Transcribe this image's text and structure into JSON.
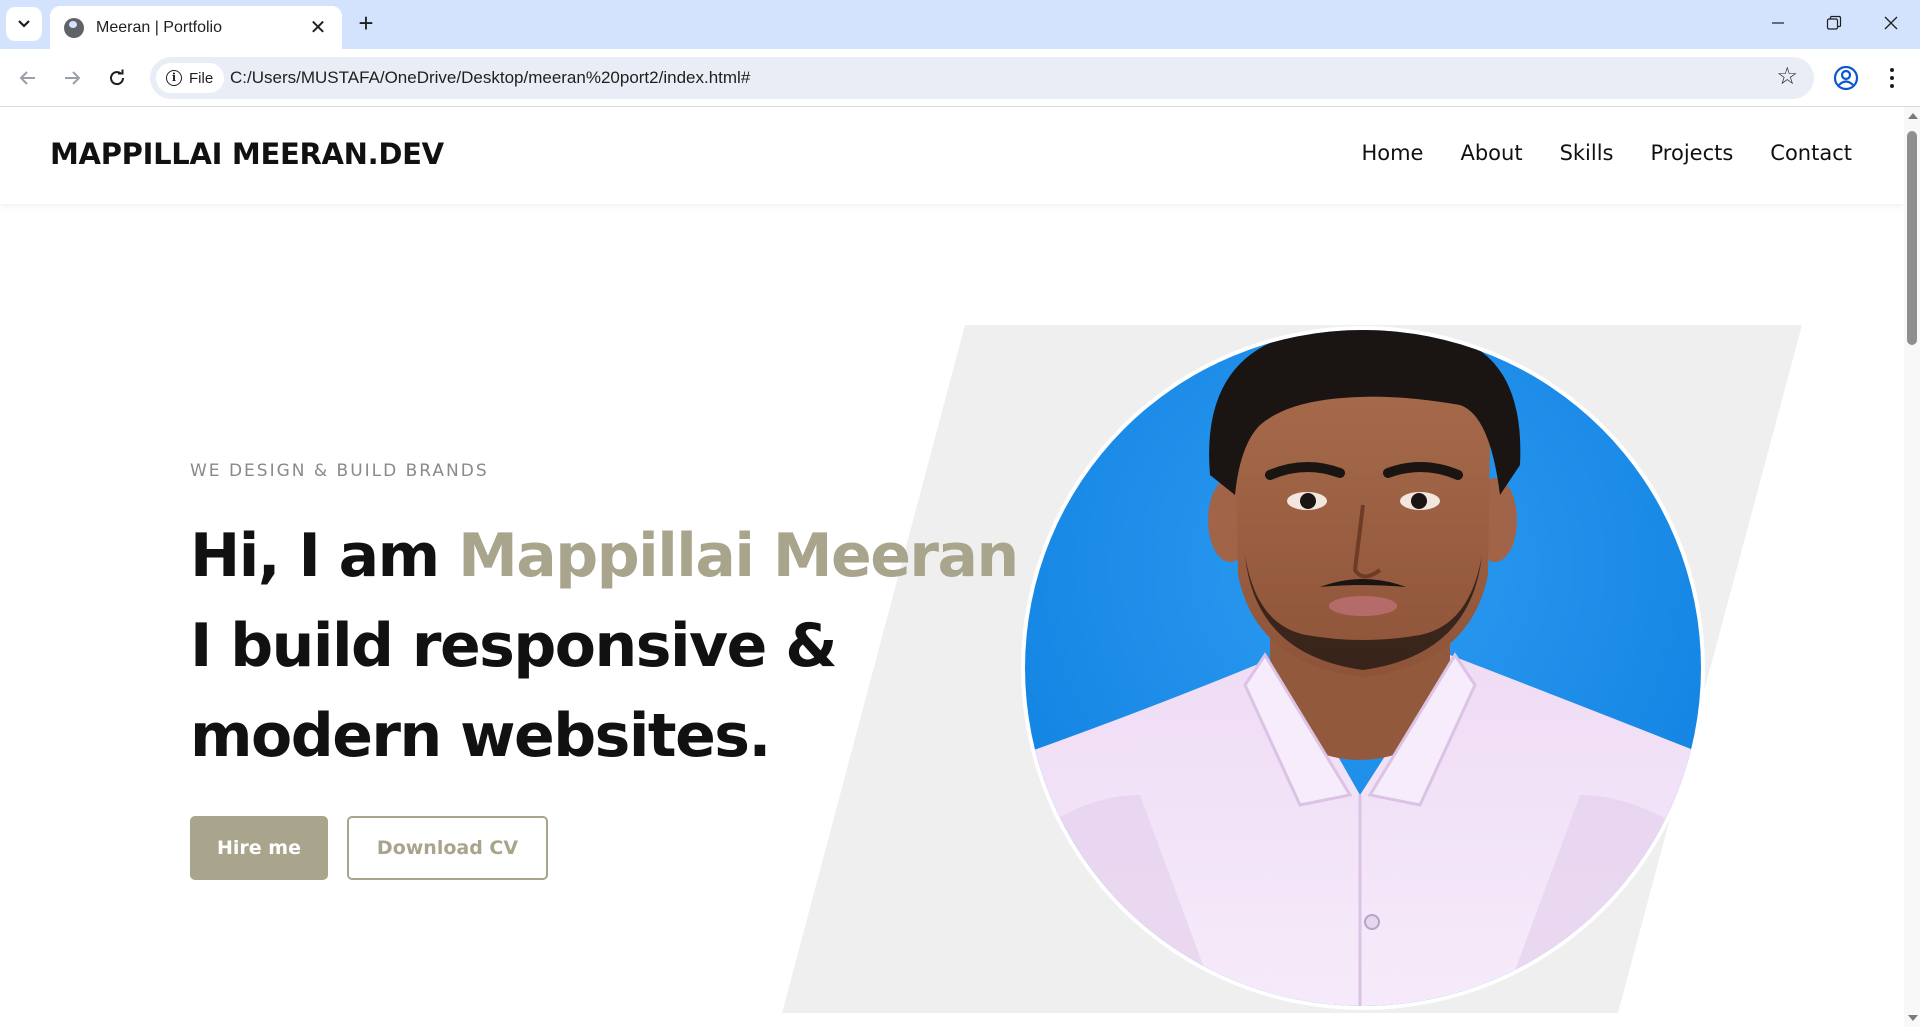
{
  "browser": {
    "tab_title": "Meeran | Portfolio",
    "url_chip": "File",
    "url": "C:/Users/MUSTAFA/OneDrive/Desktop/meeran%20port2/index.html#",
    "icons": [
      "tab-search-icon",
      "globe-icon",
      "close-icon",
      "plus-icon",
      "minimize-icon",
      "restore-icon",
      "window-close-icon",
      "back-icon",
      "forward-icon",
      "reload-icon",
      "info-icon",
      "star-icon",
      "profile-icon",
      "kebab-menu-icon"
    ]
  },
  "site": {
    "logo": "MAPPILLAI MEERAN.DEV",
    "nav": [
      "Home",
      "About",
      "Skills",
      "Projects",
      "Contact"
    ],
    "hero": {
      "subtitle": "WE DESIGN & BUILD BRANDS",
      "greeting": "Hi, I am ",
      "name": "Mappillai Meeran",
      "line2": "I build responsive &",
      "line3": "modern websites.",
      "hire_label": "Hire me",
      "cv_label": "Download CV"
    },
    "colors": {
      "accent": "#a8a58c",
      "text": "#111111",
      "shape": "#efefef",
      "photo_bg": "#1187e8"
    }
  }
}
